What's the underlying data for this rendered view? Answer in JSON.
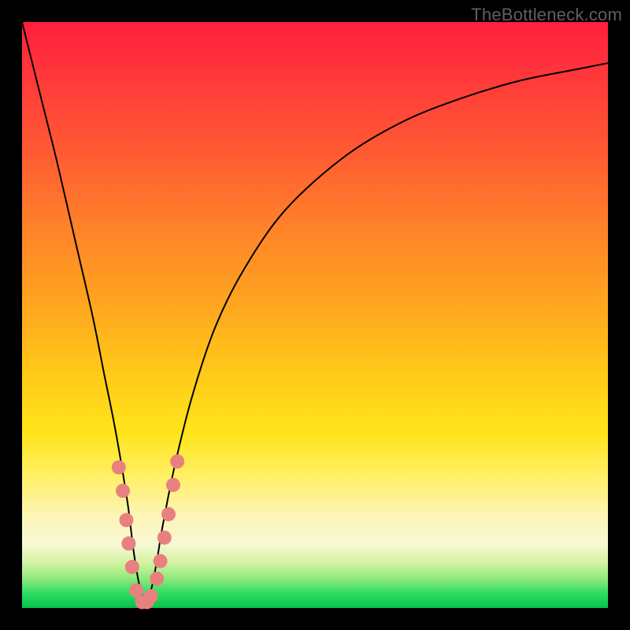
{
  "watermark": "TheBottleneck.com",
  "colors": {
    "curve": "#000000",
    "marker": "#e98080",
    "frame": "#000000"
  },
  "chart_data": {
    "type": "line",
    "title": "",
    "xlabel": "",
    "ylabel": "",
    "xlim": [
      0,
      100
    ],
    "ylim": [
      0,
      100
    ],
    "grid": false,
    "legend": false,
    "note": "Axes are unlabeled; values are estimated from pixel positions. y = 0 is the green baseline (best), y = 100 is the top red edge (worst bottleneck). The curve forms a deep V with its minimum near x ≈ 21.",
    "series": [
      {
        "name": "bottleneck-curve",
        "x": [
          0,
          3,
          6,
          9,
          12,
          14,
          16,
          18,
          19,
          20,
          21,
          22,
          23,
          24,
          26,
          29,
          33,
          38,
          45,
          55,
          65,
          75,
          85,
          95,
          100
        ],
        "y": [
          100,
          88,
          76,
          63,
          50,
          40,
          30,
          18,
          10,
          4,
          1,
          3,
          8,
          14,
          24,
          36,
          48,
          58,
          68,
          77,
          83,
          87,
          90,
          92,
          93
        ]
      }
    ],
    "markers": {
      "name": "highlighted-points",
      "note": "Salmon dots clustered around the V trough and lower limbs.",
      "points": [
        {
          "x": 16.5,
          "y": 24
        },
        {
          "x": 17.2,
          "y": 20
        },
        {
          "x": 17.8,
          "y": 15
        },
        {
          "x": 18.2,
          "y": 11
        },
        {
          "x": 18.8,
          "y": 7
        },
        {
          "x": 19.5,
          "y": 3
        },
        {
          "x": 20.5,
          "y": 1
        },
        {
          "x": 21.3,
          "y": 1
        },
        {
          "x": 22.0,
          "y": 2
        },
        {
          "x": 23.0,
          "y": 5
        },
        {
          "x": 23.6,
          "y": 8
        },
        {
          "x": 24.3,
          "y": 12
        },
        {
          "x": 25.0,
          "y": 16
        },
        {
          "x": 25.8,
          "y": 21
        },
        {
          "x": 26.5,
          "y": 25
        }
      ]
    }
  }
}
